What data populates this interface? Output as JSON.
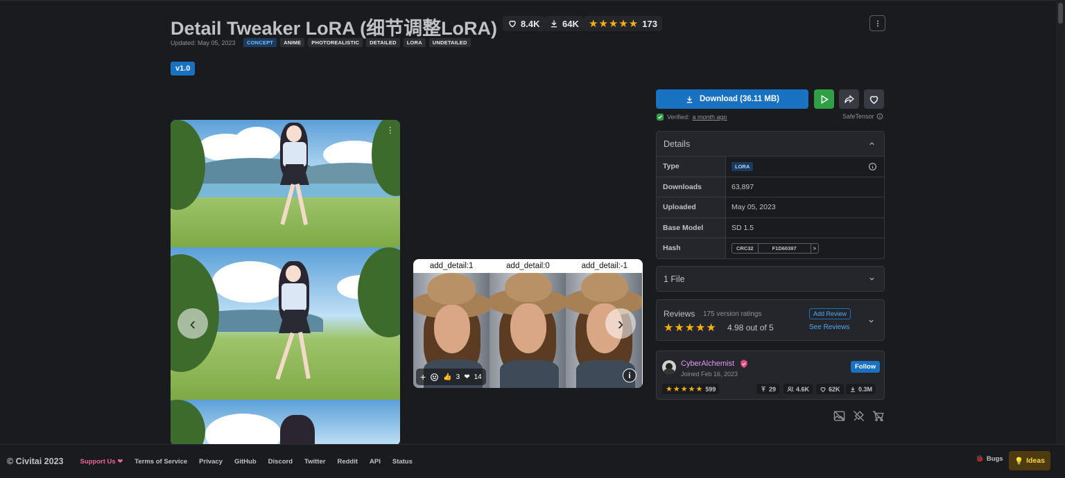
{
  "header": {
    "title": "Detail Tweaker LoRA (细节调整LoRA)",
    "likes": "8.4K",
    "downloads": "64K",
    "rating_stars": "★★★★★",
    "rating_count": "173",
    "updated": "Updated: May 05, 2023",
    "tags": [
      "CONCEPT",
      "ANIME",
      "PHOTOREALISTIC",
      "DETAILED",
      "LORA",
      "UNDETAILED"
    ],
    "version": "v1.0"
  },
  "gallery": {
    "img2_labels": [
      "add_detail:1",
      "add_detail:0",
      "add_detail:-1"
    ],
    "reaction_thumbs": "3",
    "reaction_hearts": "14",
    "prev_icon": "‹",
    "next_icon": "›"
  },
  "sidebar": {
    "download_label": "Download (36.11 MB)",
    "verified_prefix": "Verified:",
    "verified_time": "a month ago",
    "safetensor": "SafeTensor",
    "details_title": "Details",
    "details": [
      {
        "key": "Type",
        "value": "LORA"
      },
      {
        "key": "Downloads",
        "value": "63,897"
      },
      {
        "key": "Uploaded",
        "value": "May 05, 2023"
      },
      {
        "key": "Base Model",
        "value": "SD 1.5"
      },
      {
        "key": "Hash",
        "value": "F1D60397",
        "algo": "CRC32"
      }
    ],
    "files_title": "1 File",
    "reviews": {
      "title": "Reviews",
      "count": "175 version ratings",
      "stars": "★★★★★",
      "score": "4.98 out of 5",
      "add_review": "Add Review",
      "see_reviews": "See Reviews"
    },
    "author": {
      "name": "CyberAlchemist",
      "joined": "Joined Feb 16, 2023",
      "follow": "Follow",
      "stars": "★★★★★",
      "rating_count": "599",
      "uploads": "29",
      "followers": "4.6K",
      "likes": "62K",
      "downloads": "0.3M"
    }
  },
  "footer": {
    "copyright": "© Civitai 2023",
    "support": "Support Us ❤",
    "links": [
      "Terms of Service",
      "Privacy",
      "GitHub",
      "Discord",
      "Twitter",
      "Reddit",
      "API",
      "Status"
    ],
    "bugs": "Bugs",
    "ideas": "Ideas"
  },
  "colors": {
    "accent": "#1971c2",
    "play": "#2f9e44",
    "star": "#fab005",
    "bg": "#1a1b1e"
  }
}
